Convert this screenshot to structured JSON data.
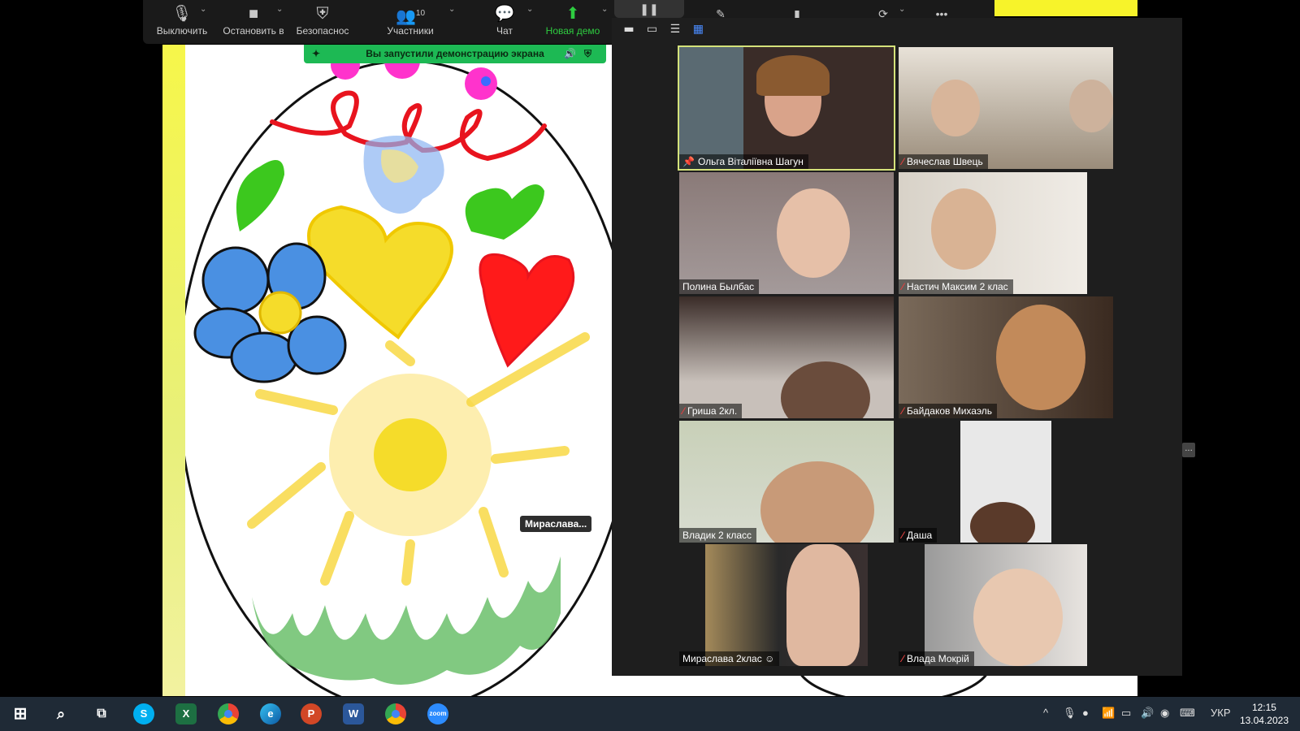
{
  "toolbar": {
    "mute_label": "Выключить",
    "video_label": "Остановить в",
    "security_label": "Безопаснос",
    "participants_label": "Участники",
    "participants_count": "10",
    "chat_label": "Чат",
    "share_label": "Новая демо",
    "more_label": "•••"
  },
  "share_banner": {
    "text": "Вы запустили демонстрацию экрана"
  },
  "annotation": {
    "name_tag": "Мираслава..."
  },
  "gallery": {
    "tiles": [
      {
        "name": "Ольга Віталіївна Шагун",
        "pinned": true,
        "muted": false
      },
      {
        "name": "Вячеслав Швець",
        "muted": true
      },
      {
        "name": "Полина Былбас",
        "muted": false
      },
      {
        "name": "Настич Максим 2 клас",
        "muted": true
      },
      {
        "name": "Гриша 2кл.",
        "muted": true
      },
      {
        "name": "Байдаков Михаэль",
        "muted": true
      },
      {
        "name": "Владик 2 класс",
        "muted": false
      },
      {
        "name": "Даша",
        "muted": true
      },
      {
        "name": "Мираслава 2клас",
        "muted": false
      },
      {
        "name": "Влада Мокрій",
        "muted": true
      }
    ],
    "more_handle": "..."
  },
  "taskbar": {
    "language": "УКР",
    "time": "12:15",
    "date": "13.04.2023",
    "apps": [
      "skype-icon",
      "excel-icon",
      "chrome-icon",
      "edge-icon",
      "powerpoint-icon",
      "word-icon",
      "chrome-profile-icon",
      "zoom-icon"
    ]
  },
  "colors": {
    "share_green": "#1db954",
    "active_speaker": "#d4e27a",
    "taskbar": "#1f2a36"
  }
}
